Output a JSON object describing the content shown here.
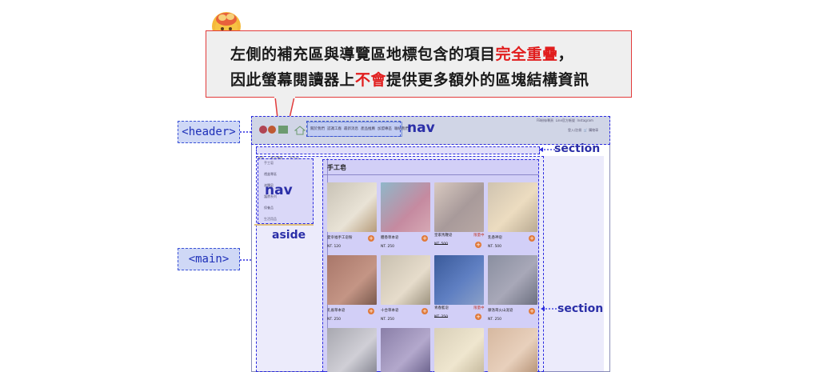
{
  "callout": {
    "line1_prefix": "左側的補充區與導覽區地標包含的項目",
    "line1_highlight": "完全重疊",
    "line1_suffix": "，",
    "line2_prefix": "因此螢幕閱讀器上",
    "line2_highlight": "不會",
    "line2_suffix": "提供更多額外的區塊結構資訊"
  },
  "tags": {
    "header": "<header>",
    "main": "<main>"
  },
  "labels": {
    "nav_top": "nav",
    "section_top": "section",
    "nav_side": "nav",
    "aside": "aside",
    "section_right": "section"
  },
  "site": {
    "top_links": [
      "FB粉絲專頁",
      "Line官方帳號",
      "Instagram"
    ],
    "menu": [
      "關於我們",
      "認識工廠",
      "最新消息",
      "產品推薦",
      "加盟專區",
      "聯絡我們"
    ],
    "login": "登入/註冊",
    "cart": "購物車",
    "breadcrumb": [
      "首頁",
      "產品專區",
      "手工皂"
    ],
    "sidebar": [
      "手工皂",
      "禮盒專區",
      "液體皂",
      "護膚系列",
      "保養品",
      "生活用品"
    ],
    "category_title": "手工皂",
    "products": [
      {
        "name": "愛幸福手工皂粉",
        "price": "NT. 120",
        "tag": ""
      },
      {
        "name": "體香草本皂",
        "price": "NT. 250",
        "tag": ""
      },
      {
        "name": "皇家馬鞭皂",
        "price": "NT. 500",
        "tag": "限量中"
      },
      {
        "name": "乳香神皂",
        "price": "NT. 500",
        "tag": ""
      },
      {
        "name": "孔雀草本皂",
        "price": "NT. 250",
        "tag": ""
      },
      {
        "name": "十合草本皂",
        "price": "NT. 250",
        "tag": ""
      },
      {
        "name": "青春藍皂",
        "price": "NT. 250",
        "tag": "限量中"
      },
      {
        "name": "摩洛哥火山泥皂",
        "price": "NT. 250",
        "tag": ""
      }
    ]
  },
  "colors": {
    "highlight": "#e11d1d",
    "landmark": "#2a2adf",
    "overlay": "#786ee6"
  }
}
